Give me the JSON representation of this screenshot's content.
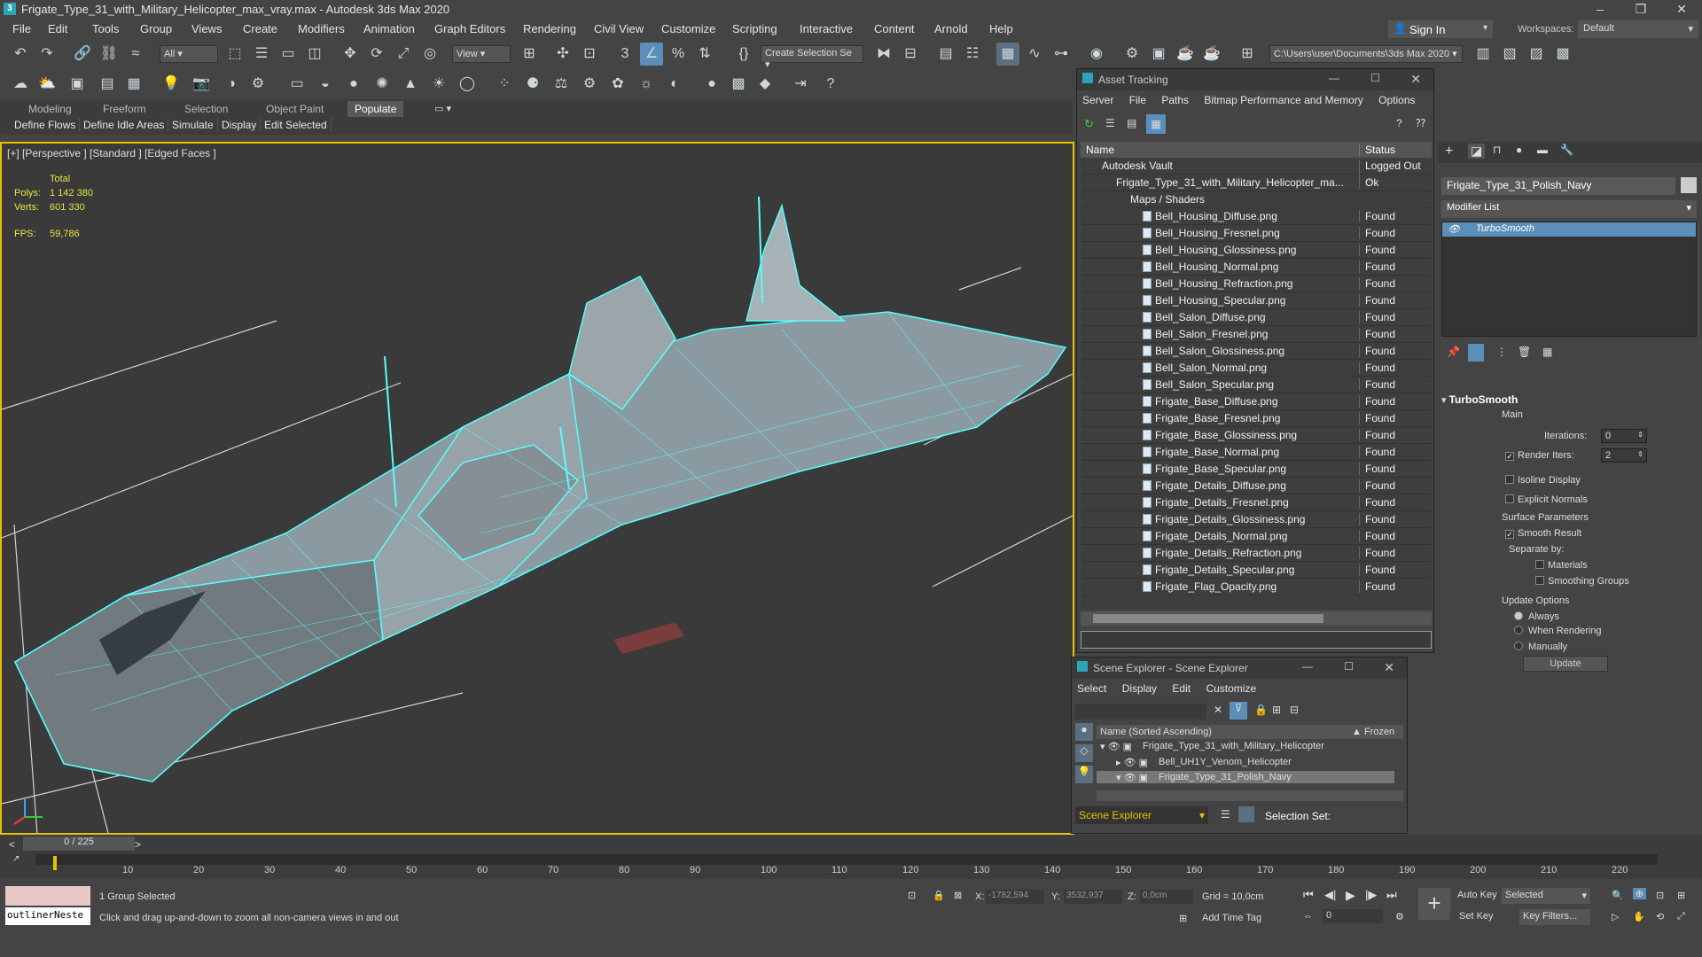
{
  "window": {
    "title": "Frigate_Type_31_with_Military_Helicopter_max_vray.max - Autodesk 3ds Max 2020"
  },
  "menu": [
    "File",
    "Edit",
    "Tools",
    "Group",
    "Views",
    "Create",
    "Modifiers",
    "Animation",
    "Graph Editors",
    "Rendering",
    "Civil View",
    "Customize",
    "Scripting",
    "Interactive",
    "Content",
    "Arnold",
    "Help"
  ],
  "signin": "Sign In",
  "workspaces_label": "Workspaces:",
  "workspace": "Default",
  "toolbar": {
    "filter": "All",
    "refcoord": "View",
    "selection_set": "Create Selection Se",
    "path": "C:\\Users\\user\\Documents\\3ds Max 2020"
  },
  "ribbon": {
    "tabs": [
      "Modeling",
      "Freeform",
      "Selection",
      "Object Paint",
      "Populate"
    ],
    "buttons": [
      "Define Flows",
      "Define Idle Areas",
      "Simulate",
      "Display",
      "Edit Selected"
    ]
  },
  "viewport": {
    "label": "[+] [Perspective ] [Standard ] [Edged Faces ]",
    "total": "Total",
    "polys_label": "Polys:",
    "polys": "1 142 380",
    "verts_label": "Verts:",
    "verts": "601 330",
    "fps_label": "FPS:",
    "fps": "59,786"
  },
  "asset_tracking": {
    "title": "Asset Tracking",
    "menu": [
      "Server",
      "File",
      "Paths",
      "Bitmap Performance and Memory",
      "Options"
    ],
    "col_name": "Name",
    "col_status": "Status",
    "vault": "Autodesk Vault",
    "vault_status": "Logged Out ...",
    "file": "Frigate_Type_31_with_Military_Helicopter_ma...",
    "file_status": "Ok",
    "maps": "Maps / Shaders",
    "files": [
      "Bell_Housing_Diffuse.png",
      "Bell_Housing_Fresnel.png",
      "Bell_Housing_Glossiness.png",
      "Bell_Housing_Normal.png",
      "Bell_Housing_Refraction.png",
      "Bell_Housing_Specular.png",
      "Bell_Salon_Diffuse.png",
      "Bell_Salon_Fresnel.png",
      "Bell_Salon_Glossiness.png",
      "Bell_Salon_Normal.png",
      "Bell_Salon_Specular.png",
      "Frigate_Base_Diffuse.png",
      "Frigate_Base_Fresnel.png",
      "Frigate_Base_Glossiness.png",
      "Frigate_Base_Normal.png",
      "Frigate_Base_Specular.png",
      "Frigate_Details_Diffuse.png",
      "Frigate_Details_Fresnel.png",
      "Frigate_Details_Glossiness.png",
      "Frigate_Details_Normal.png",
      "Frigate_Details_Refraction.png",
      "Frigate_Details_Specular.png",
      "Frigate_Flag_Opacity.png"
    ],
    "found": "Found"
  },
  "scene_explorer": {
    "title": "Scene Explorer - Scene Explorer",
    "menu": [
      "Select",
      "Display",
      "Edit",
      "Customize"
    ],
    "col_name": "Name (Sorted Ascending)",
    "col_frozen": "▲ Frozen",
    "rows": [
      "Frigate_Type_31_with_Military_Helicopter",
      "Bell_UH1Y_Venom_Helicopter",
      "Frigate_Type_31_Polish_Navy"
    ],
    "footer": "Scene Explorer",
    "selection_set": "Selection Set:"
  },
  "command_panel": {
    "object_name": "Frigate_Type_31_Polish_Navy",
    "modifier_list": "Modifier List",
    "modifier": "TurboSmooth",
    "rollout": "TurboSmooth",
    "main": "Main",
    "iterations_label": "Iterations:",
    "iterations": "0",
    "render_iters_label": "Render Iters:",
    "render_iters": "2",
    "isoline": "Isoline Display",
    "explicit": "Explicit Normals",
    "surface": "Surface Parameters",
    "smooth": "Smooth Result",
    "separate": "Separate by:",
    "materials": "Materials",
    "smoothing": "Smoothing Groups",
    "update_opts": "Update Options",
    "always": "Always",
    "when_rendering": "When Rendering",
    "manually": "Manually",
    "update_btn": "Update"
  },
  "timeline": {
    "frame": "0 / 225",
    "ticks": [
      "10",
      "20",
      "30",
      "40",
      "50",
      "60",
      "70",
      "80",
      "90",
      "100",
      "110",
      "120",
      "130",
      "140",
      "150",
      "160",
      "170",
      "180",
      "190",
      "200",
      "210",
      "220"
    ]
  },
  "status": {
    "maxscript": "outlinerNeste",
    "selected": "1 Group Selected",
    "prompt": "Click and drag up-and-down to zoom all non-camera views in and out",
    "x_label": "X:",
    "x": "-1782,594",
    "y_label": "Y:",
    "y": "3532,937",
    "z_label": "Z:",
    "z": "0,0cm",
    "grid": "Grid = 10,0cm",
    "add_time_tag": "Add Time Tag",
    "auto_key": "Auto Key",
    "set_key": "Set Key",
    "key_mode": "Selected",
    "key_filters": "Key Filters...",
    "frame_field": "0"
  }
}
